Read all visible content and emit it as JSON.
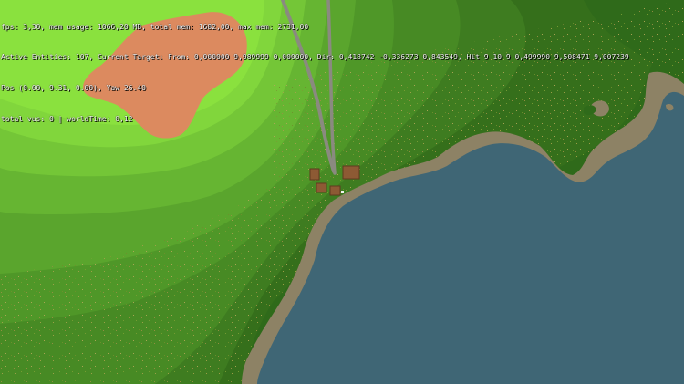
{
  "debug": {
    "line1": "fps: 3,30, mem usage: 1066,20 MB, total mem: 1682,00, max mem: 2731,00",
    "line2": "Active Entities: 107, Current Target: From: 0,000000 9,989999 0,000000, Dir: 0,418742 -0,336273 0,843549, Hit 9 10 9 0,499990 9,508471 9,007239",
    "line3": "Pos (0.00, 9.31, 0.00), Yaw 26.40",
    "line4": "total vus: 0 | worldTime: 0,12"
  },
  "colors": {
    "water": "#3f6675",
    "shore": "#8d8265",
    "sand_patch": "#dc8a5f",
    "grass_bright": "#8ae13e",
    "grass_mid": "#5cab30",
    "grass_dark": "#2f6a1a",
    "road": "#8a8a80",
    "hut": "#8d5a34"
  },
  "icons": [
    "hut-icon",
    "cursor-marker-icon"
  ]
}
